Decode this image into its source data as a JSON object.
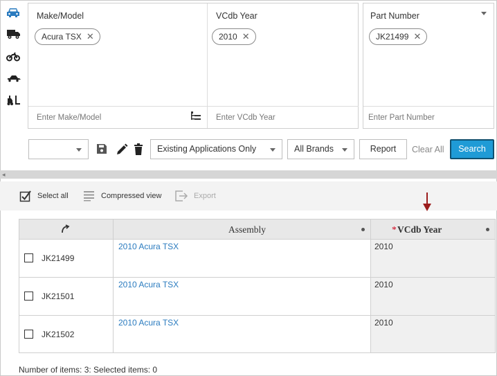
{
  "vehicle_types": [
    "car-icon",
    "truck-icon",
    "motorcycle-icon",
    "snowmobile-icon",
    "forklift-icon"
  ],
  "filters": {
    "make_model": {
      "label": "Make/Model",
      "chip": "Acura TSX",
      "placeholder": "Enter Make/Model"
    },
    "vcdb_year": {
      "label": "VCdb Year",
      "chip": "2010",
      "placeholder": "Enter VCdb Year"
    },
    "part_number": {
      "label": "Part Number",
      "chip": "JK21499",
      "placeholder": "Enter Part Number"
    }
  },
  "toolbar": {
    "saved_search_value": "",
    "applications_filter": "Existing Applications Only",
    "brands_filter": "All Brands",
    "report_label": "Report",
    "clear_all_label": "Clear All",
    "search_label": "Search"
  },
  "grid_toolbar": {
    "select_all_label": "Select all",
    "compressed_view_label": "Compressed view",
    "export_label": "Export"
  },
  "table": {
    "columns": {
      "assembly": "Assembly",
      "required_marker": "*",
      "vcdb_year": "VCdb Year"
    },
    "rows": [
      {
        "part_number": "JK21499",
        "assembly": "2010 Acura TSX",
        "vcdb_year": "2010"
      },
      {
        "part_number": "JK21501",
        "assembly": "2010 Acura TSX",
        "vcdb_year": "2010"
      },
      {
        "part_number": "JK21502",
        "assembly": "2010 Acura TSX",
        "vcdb_year": "2010"
      }
    ]
  },
  "footer": {
    "status": "Number of items: 3: Selected items: 0"
  },
  "colors": {
    "accent": "#1f9bd6",
    "link": "#2a7bbf",
    "vehicle_icon_active": "#2a7bbf",
    "annotation_arrow": "#9b1c1c"
  }
}
